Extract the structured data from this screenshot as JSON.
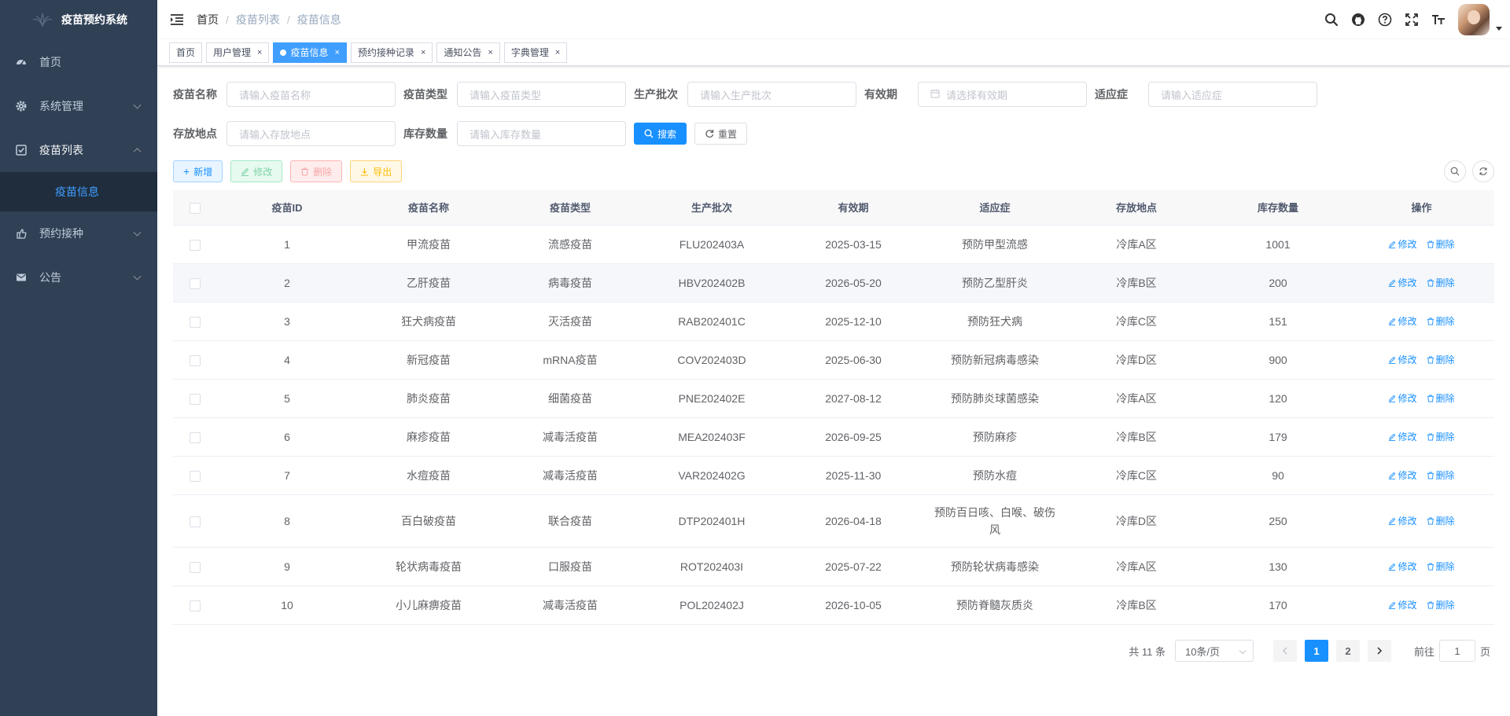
{
  "app": {
    "title": "疫苗预约系统"
  },
  "sidebar": {
    "items": [
      {
        "label": "首页",
        "icon": "dashboard-icon"
      },
      {
        "label": "系统管理",
        "icon": "gear-icon"
      },
      {
        "label": "疫苗列表",
        "icon": "checkbox-icon",
        "children": [
          "疫苗信息"
        ]
      },
      {
        "label": "预约接种",
        "icon": "hand-icon"
      },
      {
        "label": "公告",
        "icon": "mail-icon"
      }
    ]
  },
  "navbar": {
    "breadcrumb": [
      "首页",
      "疫苗列表",
      "疫苗信息"
    ]
  },
  "tags": [
    {
      "label": "首页",
      "active": false
    },
    {
      "label": "用户管理",
      "active": false
    },
    {
      "label": "疫苗信息",
      "active": true
    },
    {
      "label": "预约接种记录",
      "active": false
    },
    {
      "label": "通知公告",
      "active": false
    },
    {
      "label": "字典管理",
      "active": false
    }
  ],
  "search": {
    "name": {
      "label": "疫苗名称",
      "placeholder": "请输入疫苗名称"
    },
    "type": {
      "label": "疫苗类型",
      "placeholder": "请输入疫苗类型"
    },
    "batch": {
      "label": "生产批次",
      "placeholder": "请输入生产批次"
    },
    "expiry": {
      "label": "有效期",
      "placeholder": "请选择有效期"
    },
    "indication": {
      "label": "适应症",
      "placeholder": "请输入适应症"
    },
    "location": {
      "label": "存放地点",
      "placeholder": "请输入存放地点"
    },
    "stock": {
      "label": "库存数量",
      "placeholder": "请输入库存数量"
    },
    "search_btn": "搜索",
    "reset_btn": "重置"
  },
  "toolbar": {
    "add": "新增",
    "edit": "修改",
    "delete": "删除",
    "export": "导出"
  },
  "table": {
    "columns": [
      "疫苗ID",
      "疫苗名称",
      "疫苗类型",
      "生产批次",
      "有效期",
      "适应症",
      "存放地点",
      "库存数量",
      "操作"
    ],
    "edit_label": "修改",
    "delete_label": "删除",
    "rows": [
      [
        "1",
        "甲流疫苗",
        "流感疫苗",
        "FLU202403A",
        "2025-03-15",
        "预防甲型流感",
        "冷库A区",
        "1001"
      ],
      [
        "2",
        "乙肝疫苗",
        "病毒疫苗",
        "HBV202402B",
        "2026-05-20",
        "预防乙型肝炎",
        "冷库B区",
        "200"
      ],
      [
        "3",
        "狂犬病疫苗",
        "灭活疫苗",
        "RAB202401C",
        "2025-12-10",
        "预防狂犬病",
        "冷库C区",
        "151"
      ],
      [
        "4",
        "新冠疫苗",
        "mRNA疫苗",
        "COV202403D",
        "2025-06-30",
        "预防新冠病毒感染",
        "冷库D区",
        "900"
      ],
      [
        "5",
        "肺炎疫苗",
        "细菌疫苗",
        "PNE202402E",
        "2027-08-12",
        "预防肺炎球菌感染",
        "冷库A区",
        "120"
      ],
      [
        "6",
        "麻疹疫苗",
        "减毒活疫苗",
        "MEA202403F",
        "2026-09-25",
        "预防麻疹",
        "冷库B区",
        "179"
      ],
      [
        "7",
        "水痘疫苗",
        "减毒活疫苗",
        "VAR202402G",
        "2025-11-30",
        "预防水痘",
        "冷库C区",
        "90"
      ],
      [
        "8",
        "百白破疫苗",
        "联合疫苗",
        "DTP202401H",
        "2026-04-18",
        "预防百日咳、白喉、破伤风",
        "冷库D区",
        "250"
      ],
      [
        "9",
        "轮状病毒疫苗",
        "口服疫苗",
        "ROT202403I",
        "2025-07-22",
        "预防轮状病毒感染",
        "冷库A区",
        "130"
      ],
      [
        "10",
        "小儿麻痹疫苗",
        "减毒活疫苗",
        "POL202402J",
        "2026-10-05",
        "预防脊髓灰质炎",
        "冷库B区",
        "170"
      ]
    ]
  },
  "pagination": {
    "total": "共 11 条",
    "page_size": "10条/页",
    "pages": [
      "1",
      "2"
    ],
    "current": "1",
    "goto_prefix": "前往",
    "goto_value": "1",
    "goto_suffix": "页"
  },
  "colors": {
    "sidebar_bg": "#304156",
    "primary": "#1890ff",
    "active_menu": "#409eff"
  }
}
